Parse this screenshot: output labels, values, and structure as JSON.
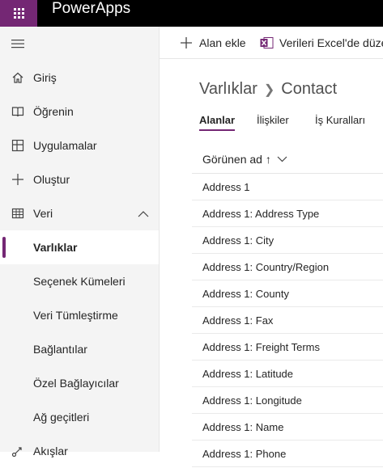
{
  "topbar": {
    "app_title": "PowerApps"
  },
  "sidebar": {
    "items": [
      {
        "label": "Giriş",
        "icon": "home-icon"
      },
      {
        "label": "Öğrenin",
        "icon": "book-icon"
      },
      {
        "label": "Uygulamalar",
        "icon": "apps-icon"
      },
      {
        "label": "Oluştur",
        "icon": "plus-icon"
      },
      {
        "label": "Veri",
        "icon": "table-icon",
        "expanded": true
      },
      {
        "label": "Varlıklar",
        "active": true
      },
      {
        "label": "Seçenek Kümeleri"
      },
      {
        "label": "Veri Tümleştirme"
      },
      {
        "label": "Bağlantılar"
      },
      {
        "label": "Özel Bağlayıcılar"
      },
      {
        "label": "Ağ geçitleri"
      },
      {
        "label": "Akışlar",
        "icon": "flow-icon"
      }
    ]
  },
  "commands": {
    "add_field": "Alan ekle",
    "export_excel": "Verileri Excel'de düze"
  },
  "breadcrumb": {
    "parent": "Varlıklar",
    "current": "Contact"
  },
  "tabs": [
    "Alanlar",
    "İlişkiler",
    "İş Kuralları"
  ],
  "table": {
    "column_header": "Görünen ad ↑",
    "rows": [
      "Address 1",
      "Address 1: Address Type",
      "Address 1: City",
      "Address 1: Country/Region",
      "Address 1: County",
      "Address 1: Fax",
      "Address 1: Freight Terms",
      "Address 1: Latitude",
      "Address 1: Longitude",
      "Address 1: Name",
      "Address 1: Phone"
    ]
  },
  "colors": {
    "accent": "#742774",
    "topbar": "#000000",
    "sidebar_bg": "#f4f4f4"
  }
}
